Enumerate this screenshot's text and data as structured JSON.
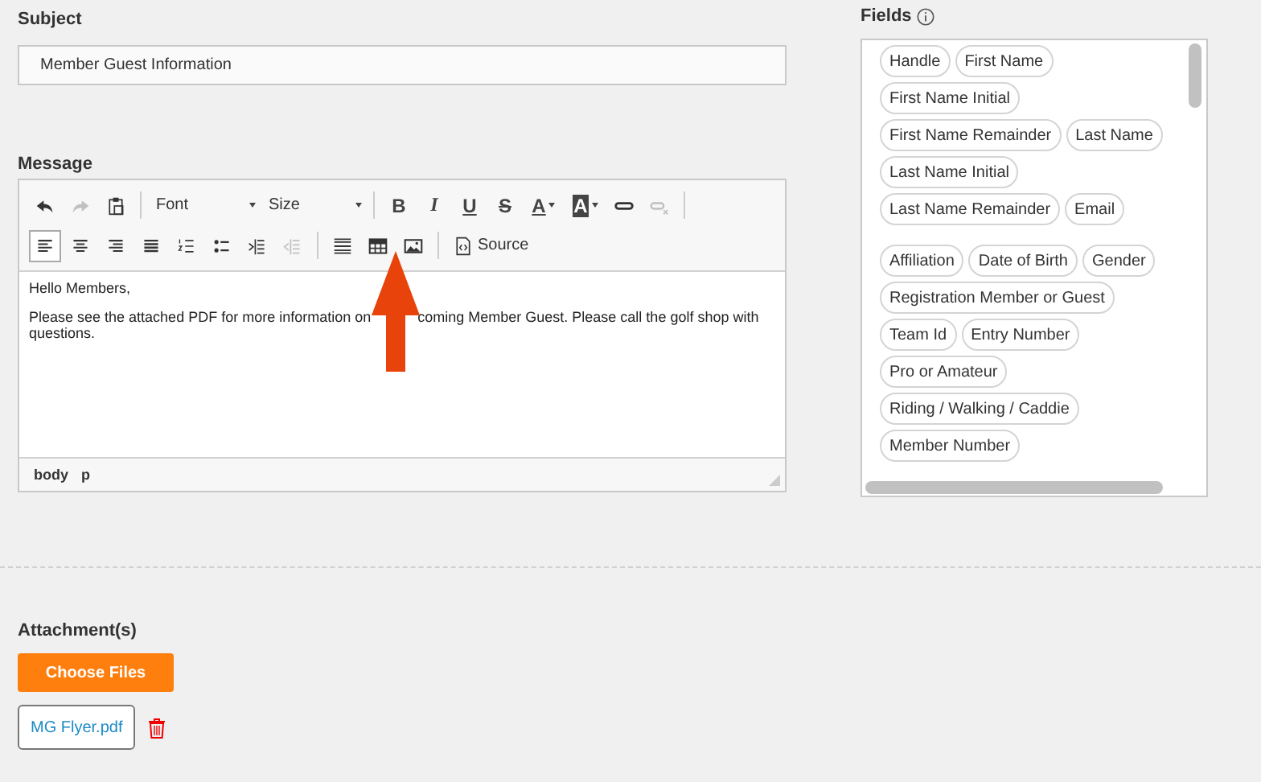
{
  "subject": {
    "label": "Subject",
    "value": "Member Guest Information"
  },
  "message": {
    "label": "Message",
    "toolbar": [
      [
        {
          "kind": "undo",
          "disabled": false,
          "selected": false
        },
        {
          "kind": "redo",
          "disabled": true,
          "selected": false
        },
        {
          "kind": "paste",
          "disabled": false,
          "selected": false
        },
        {
          "kind": "separator"
        },
        {
          "kind": "dropdown",
          "label": "Font"
        },
        {
          "kind": "dropdown",
          "label": "Size"
        },
        {
          "kind": "separator"
        },
        {
          "kind": "bold",
          "glyph": "B",
          "disabled": false,
          "selected": false
        },
        {
          "kind": "italic",
          "glyph": "I",
          "disabled": false,
          "selected": false
        },
        {
          "kind": "underline",
          "glyph": "U",
          "disabled": false,
          "selected": false
        },
        {
          "kind": "strike",
          "glyph": "S",
          "disabled": false,
          "selected": false
        },
        {
          "kind": "textcolor",
          "glyph": "A",
          "disabled": false,
          "selected": false
        },
        {
          "kind": "bgcolor",
          "glyph": "A",
          "disabled": false,
          "selected": false
        },
        {
          "kind": "link",
          "disabled": false,
          "selected": false
        },
        {
          "kind": "unlink",
          "disabled": true,
          "selected": false
        },
        {
          "kind": "separator"
        }
      ],
      [
        {
          "kind": "alignleft",
          "disabled": false,
          "selected": true
        },
        {
          "kind": "aligncenter",
          "disabled": false,
          "selected": false
        },
        {
          "kind": "alignright",
          "disabled": false,
          "selected": false
        },
        {
          "kind": "justify",
          "disabled": false,
          "selected": false
        },
        {
          "kind": "numlist",
          "disabled": false,
          "selected": false
        },
        {
          "kind": "bullist",
          "disabled": false,
          "selected": false
        },
        {
          "kind": "indent",
          "disabled": false,
          "selected": false
        },
        {
          "kind": "outdent",
          "disabled": true,
          "selected": false
        },
        {
          "kind": "separator"
        },
        {
          "kind": "hr",
          "disabled": false,
          "selected": false
        },
        {
          "kind": "table",
          "disabled": false,
          "selected": false
        },
        {
          "kind": "image",
          "disabled": false,
          "selected": false
        },
        {
          "kind": "separator"
        },
        {
          "kind": "source",
          "label": "Source",
          "disabled": false,
          "selected": false
        }
      ]
    ],
    "paragraphs": [
      [
        [
          "Hello Members,"
        ]
      ],
      [
        [
          "Please see the attached PDF for more information on",
          "coming Member Guest. Please call the golf shop with"
        ],
        [
          "questions."
        ]
      ]
    ],
    "path": [
      "body",
      "p"
    ]
  },
  "annotation": {
    "kind": "arrow"
  },
  "fields": {
    "label": "Fields",
    "groups": [
      {
        "rows": [
          [
            "Handle",
            "First Name"
          ],
          [
            "First Name Initial"
          ],
          [
            "First Name Remainder",
            "Last Name"
          ],
          [
            "Last Name Initial"
          ],
          [
            "Last Name Remainder",
            "Email"
          ]
        ]
      },
      {
        "rows": [
          [
            "Affiliation",
            "Date of Birth",
            "Gender"
          ],
          [
            "Registration Member or Guest"
          ],
          [
            "Team Id",
            "Entry Number"
          ],
          [
            "Pro or Amateur"
          ],
          [
            "Riding / Walking / Caddie"
          ],
          [
            "Member Number"
          ]
        ]
      }
    ]
  },
  "attachments": {
    "label": "Attachment(s)",
    "button": "Choose Files",
    "files": [
      {
        "name": "MG Flyer.pdf"
      }
    ]
  }
}
